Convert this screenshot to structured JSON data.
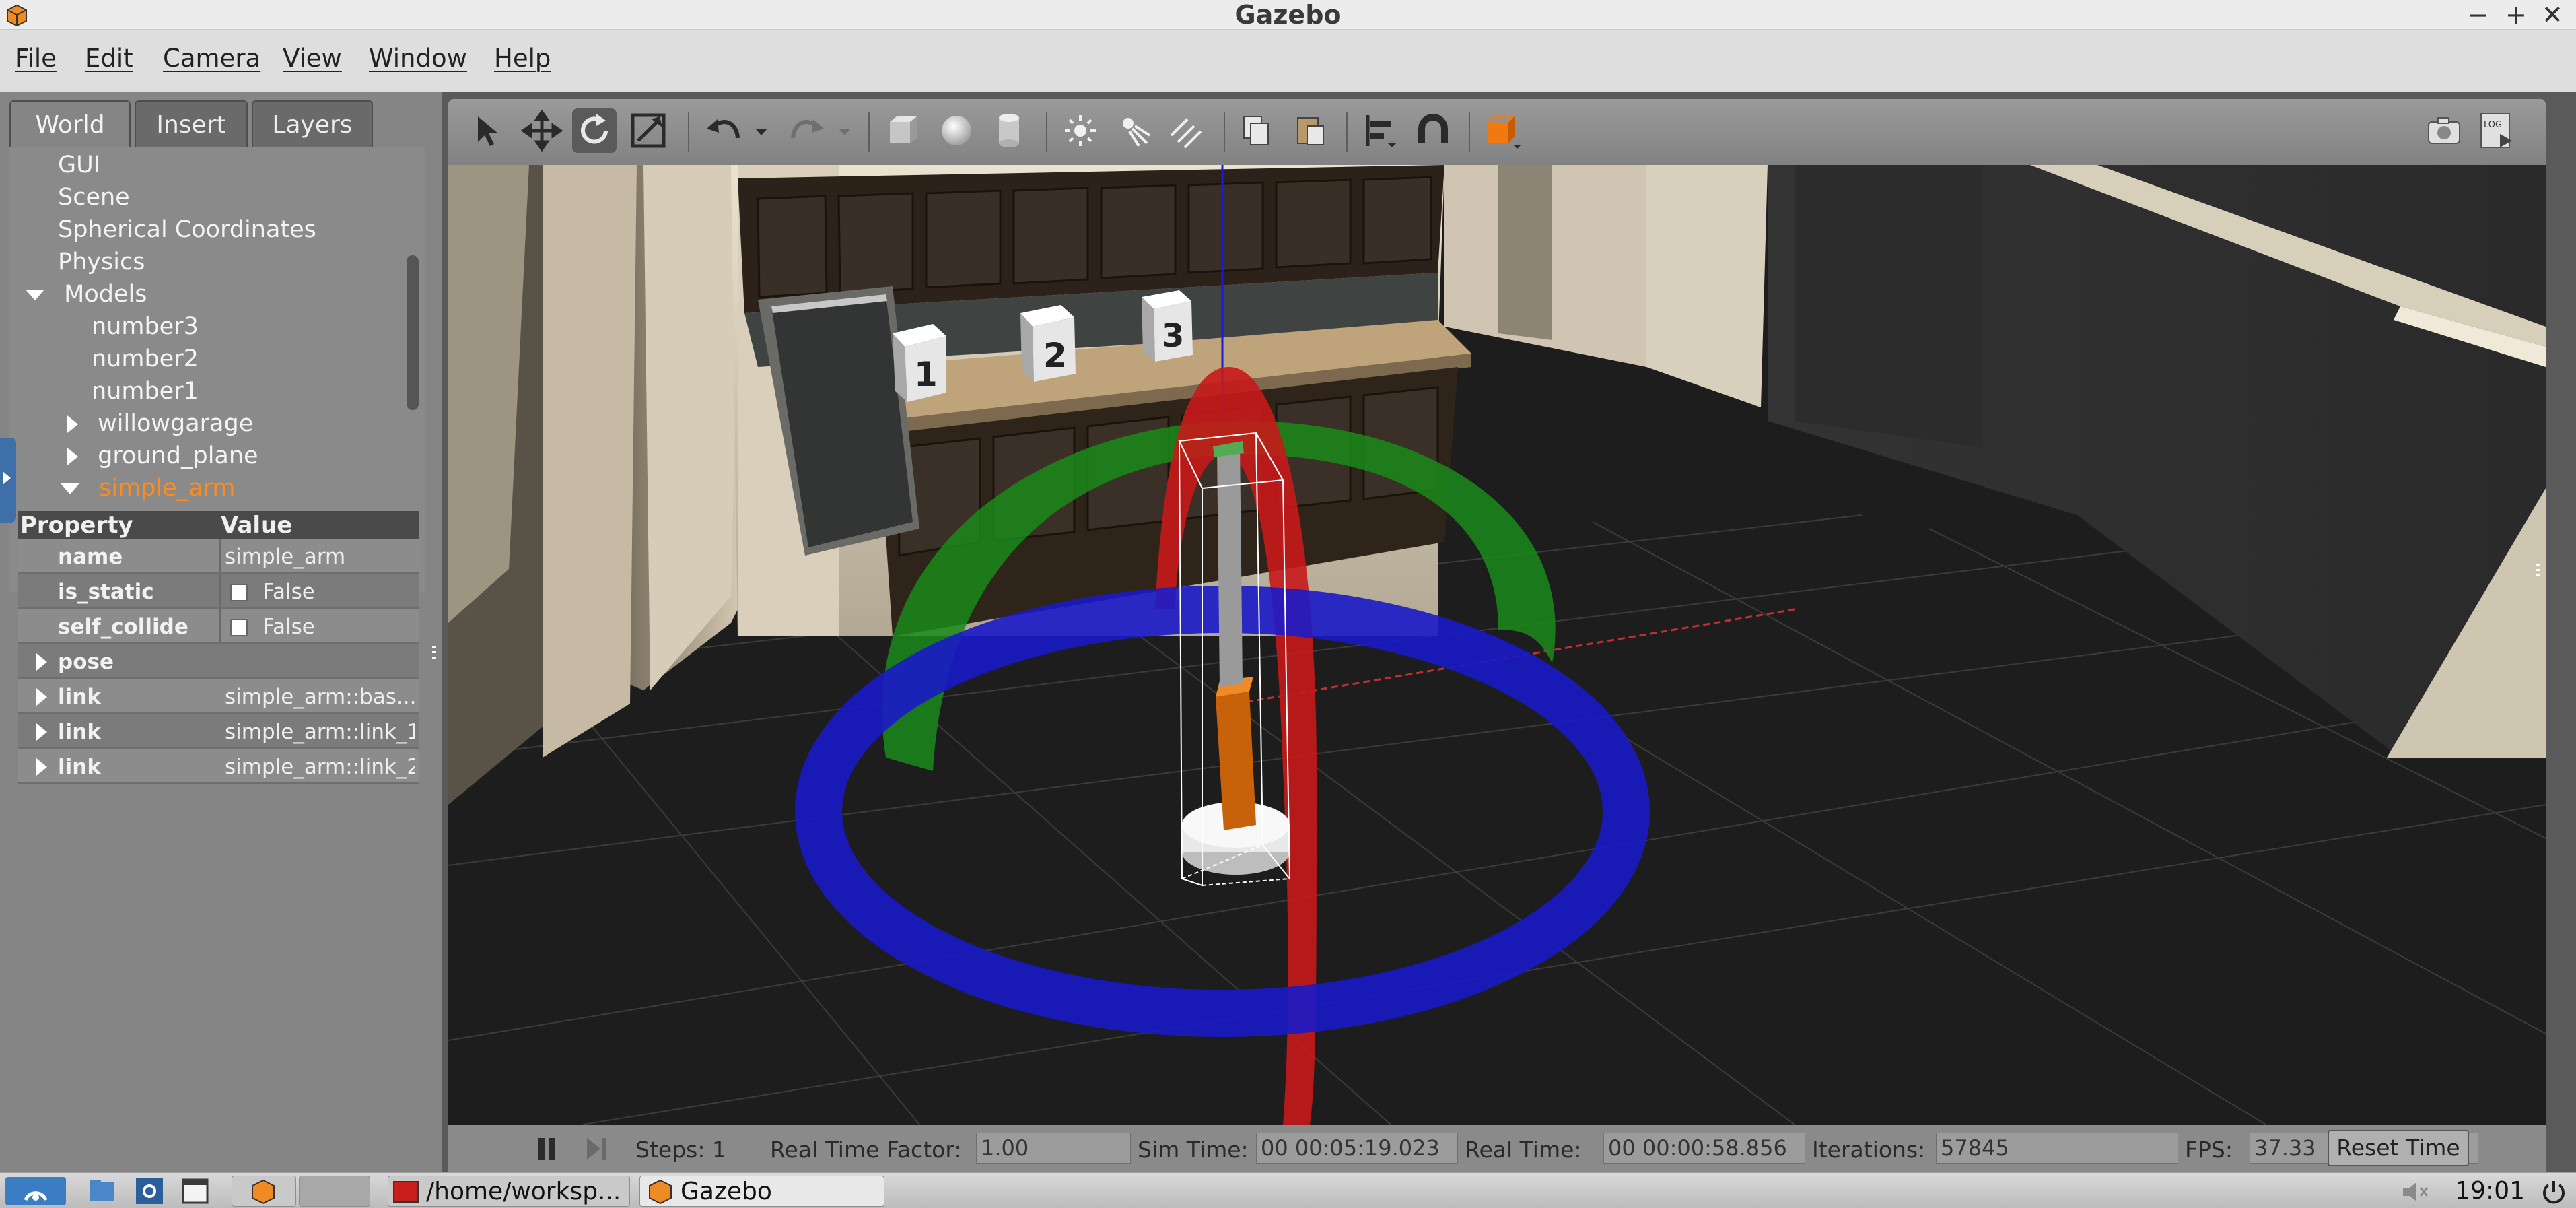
{
  "window": {
    "title": "Gazebo",
    "minimize": "−",
    "maximize": "+",
    "close": "✕"
  },
  "menu": [
    "File",
    "Edit",
    "Camera",
    "View",
    "Window",
    "Help"
  ],
  "left_panel": {
    "tabs": [
      "World",
      "Insert",
      "Layers"
    ],
    "tree": {
      "gui": "GUI",
      "scene": "Scene",
      "spherical": "Spherical Coordinates",
      "physics": "Physics",
      "models": "Models",
      "number3": "number3",
      "number2": "number2",
      "number1": "number1",
      "willowgarage": "willowgarage",
      "ground_plane": "ground_plane",
      "simple_arm": "simple_arm"
    },
    "properties": {
      "header": {
        "property": "Property",
        "value": "Value"
      },
      "name": {
        "key": "name",
        "value": "simple_arm"
      },
      "is_static": {
        "key": "is_static",
        "value": "False"
      },
      "self_collide": {
        "key": "self_collide",
        "value": "False"
      },
      "pose": {
        "key": "pose"
      },
      "link1": {
        "key": "link",
        "value": "simple_arm::bas..."
      },
      "link2": {
        "key": "link",
        "value": "simple_arm::link_1"
      },
      "link3": {
        "key": "link",
        "value": "simple_arm::link_2"
      }
    }
  },
  "toolbar": {
    "icons": [
      "select-arrow-icon",
      "translate-icon",
      "rotate-icon",
      "scale-icon",
      "undo-icon",
      "redo-icon",
      "box-icon",
      "sphere-icon",
      "cylinder-icon",
      "point-light-icon",
      "spot-light-icon",
      "directional-light-icon",
      "copy-icon",
      "paste-icon",
      "align-icon",
      "snap-magnet-icon",
      "view-angle-icon",
      "screenshot-icon",
      "log-icon"
    ],
    "log_label": "LOG"
  },
  "scene": {
    "cube_labels": [
      "1",
      "2",
      "3"
    ]
  },
  "bottom_bar": {
    "steps_label": "Steps:",
    "steps_value": "1",
    "rtf_label": "Real Time Factor:",
    "rtf_value": "1.00",
    "sim_time_label": "Sim Time:",
    "sim_time_value": "00 00:05:19.023",
    "real_time_label": "Real Time:",
    "real_time_value": "00 00:00:58.856",
    "iterations_label": "Iterations:",
    "iterations_value": "57845",
    "fps_label": "FPS:",
    "fps_value": "37.33",
    "reset_label": "Reset Time"
  },
  "taskbar": {
    "task_terminal": "/home/worksp...",
    "task_gazebo": "Gazebo",
    "clock": "19:01"
  },
  "colors": {
    "selected": "#ff8c1a",
    "ring_x": "#d01818",
    "ring_y": "#1a9a1a",
    "ring_z": "#1a1ad0",
    "arm_link": "#c8620a"
  }
}
